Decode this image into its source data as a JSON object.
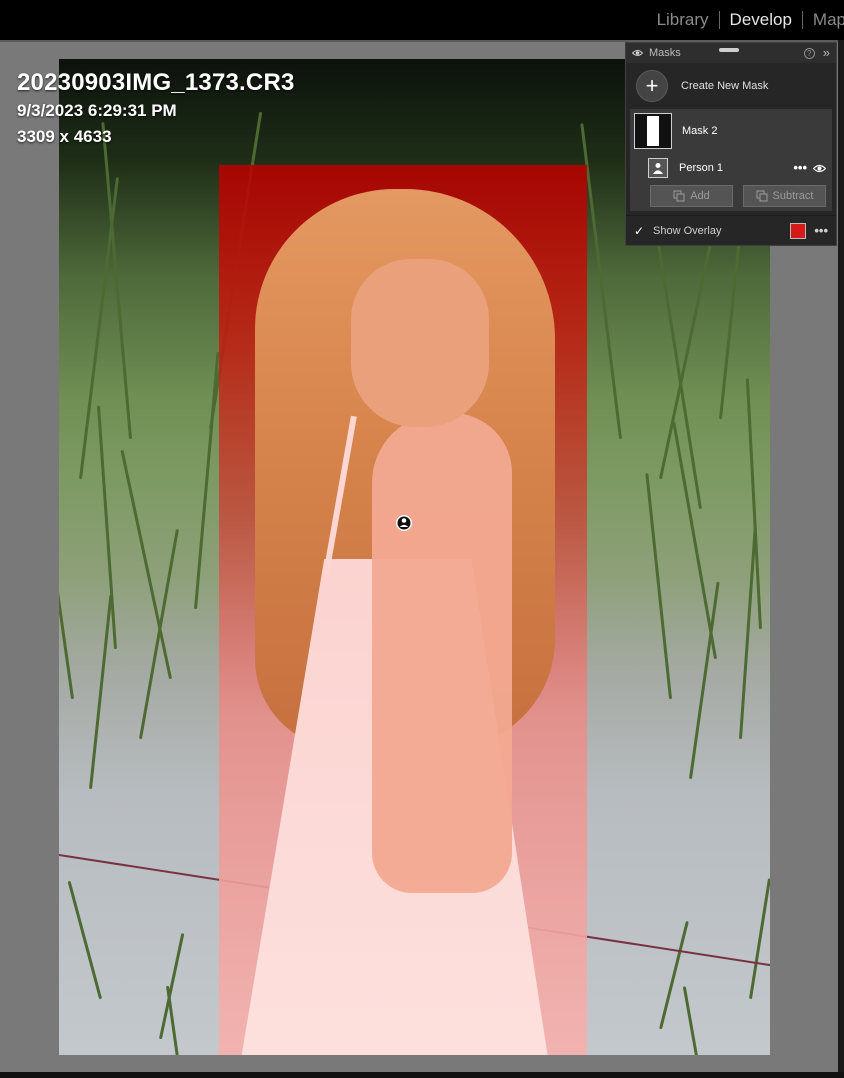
{
  "modules": [
    {
      "label": "Library",
      "active": false
    },
    {
      "label": "Develop",
      "active": true
    },
    {
      "label": "Map",
      "active": false
    }
  ],
  "photo_info": {
    "filename": "20230903IMG_1373.CR3",
    "datetime": "9/3/2023 6:29:31 PM",
    "dimensions": "3309 x 4633"
  },
  "masks_panel": {
    "title": "Masks",
    "create_label": "Create New Mask",
    "mask_name": "Mask 2",
    "component_name": "Person 1",
    "add_label": "Add",
    "subtract_label": "Subtract",
    "show_overlay_label": "Show Overlay",
    "show_overlay_checked": true,
    "overlay_color": "#d61a1a"
  },
  "colors": {
    "mask_overlay": "#b90000",
    "panel_bg": "#262626",
    "canvas_bg": "#797979"
  }
}
